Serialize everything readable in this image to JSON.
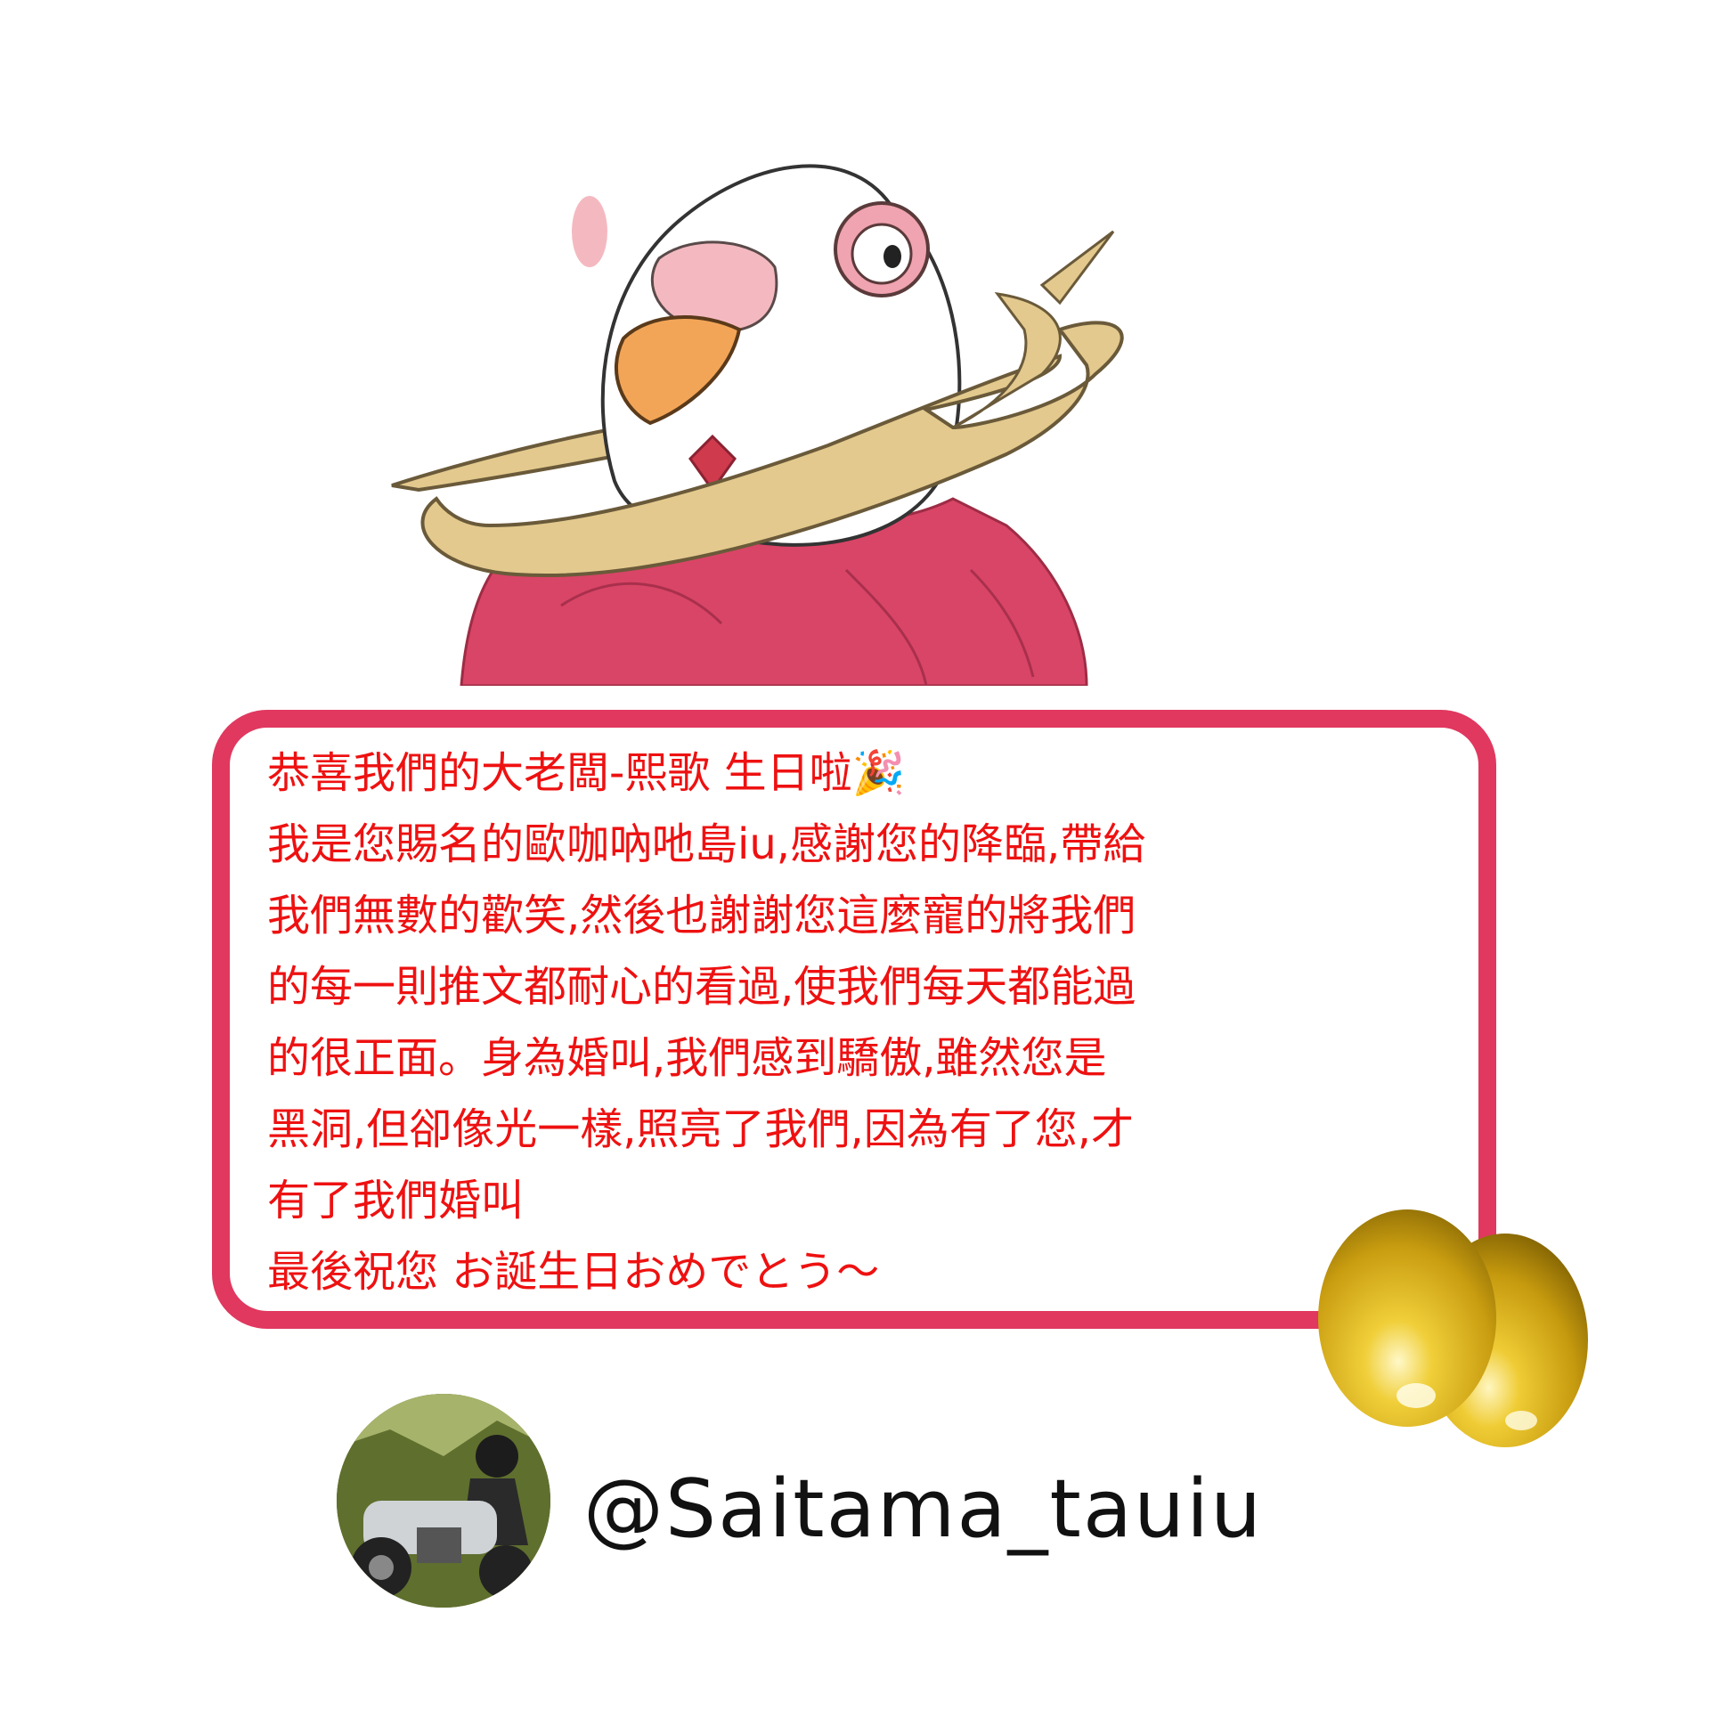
{
  "message": {
    "lines": [
      "恭喜我們的大老闆-熙歌 生日啦🎉",
      "我是您賜名的歐咖吶吔島iu,感謝您的降臨,帶給",
      "我們無數的歡笑,然後也謝謝您這麼寵的將我們",
      "的每一則推文都耐心的看過,使我們每天都能過",
      "的很正面。身為婚叫,我們感到驕傲,雖然您是",
      "黑洞,但卻像光一樣,照亮了我們,因為有了您,才",
      "有了我們婚叫",
      "最後祝您 お誕生日おめでとう～"
    ],
    "text_color": "#ee1111",
    "border_color": "#e0385f"
  },
  "author": {
    "handle": "@Saitama_tauiu",
    "avatar": "motorcycle-rider-photo"
  },
  "decorations": {
    "illustration": "white-bird-in-red-sweater-with-golden-ring",
    "eggs": "golden-eggs"
  }
}
